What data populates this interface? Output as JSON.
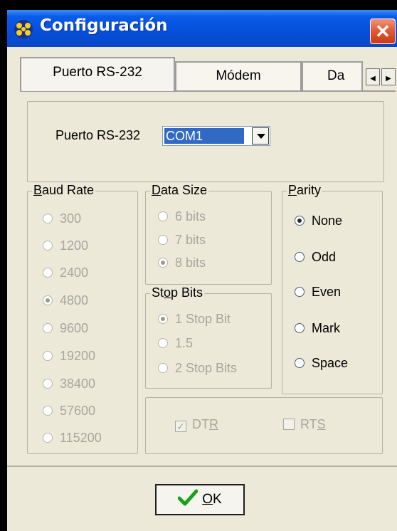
{
  "window": {
    "title": "Configuración",
    "close_glyph": "✕",
    "title_icon": "app-dots-icon"
  },
  "tabs": [
    {
      "label": "Puerto RS-232",
      "active": true
    },
    {
      "label": "Módem",
      "active": false
    },
    {
      "label": "Da",
      "active": false
    }
  ],
  "tab_scroll": {
    "left": "◀",
    "right": "▶"
  },
  "port": {
    "label": "Puerto RS-232",
    "selected": "COM1"
  },
  "baud_rate": {
    "legend": "Baud Rate",
    "options": [
      "300",
      "1200",
      "2400",
      "4800",
      "9600",
      "19200",
      "38400",
      "57600",
      "115200"
    ],
    "selected": "4800",
    "enabled": false
  },
  "data_size": {
    "legend": "Data Size",
    "options": [
      "6 bits",
      "7 bits",
      "8 bits"
    ],
    "selected": "8 bits",
    "enabled": false
  },
  "stop_bits": {
    "legend": "Stop Bits",
    "options": [
      "1 Stop Bit",
      "1.5",
      "2 Stop Bits"
    ],
    "selected": "1 Stop Bit",
    "enabled": false
  },
  "parity": {
    "legend": "Parity",
    "options": [
      "None",
      "Odd",
      "Even",
      "Mark",
      "Space"
    ],
    "selected": "None",
    "enabled": true
  },
  "flow": {
    "dtr_label": "DTR",
    "dtr_checked": true,
    "rts_label": "RTS",
    "rts_checked": false
  },
  "ok_button": {
    "label": "OK"
  },
  "colors": {
    "title_bar": "#0550DD",
    "selection": "#316AC5",
    "close": "#E2572F",
    "ok_check": "#1E9E1E"
  }
}
